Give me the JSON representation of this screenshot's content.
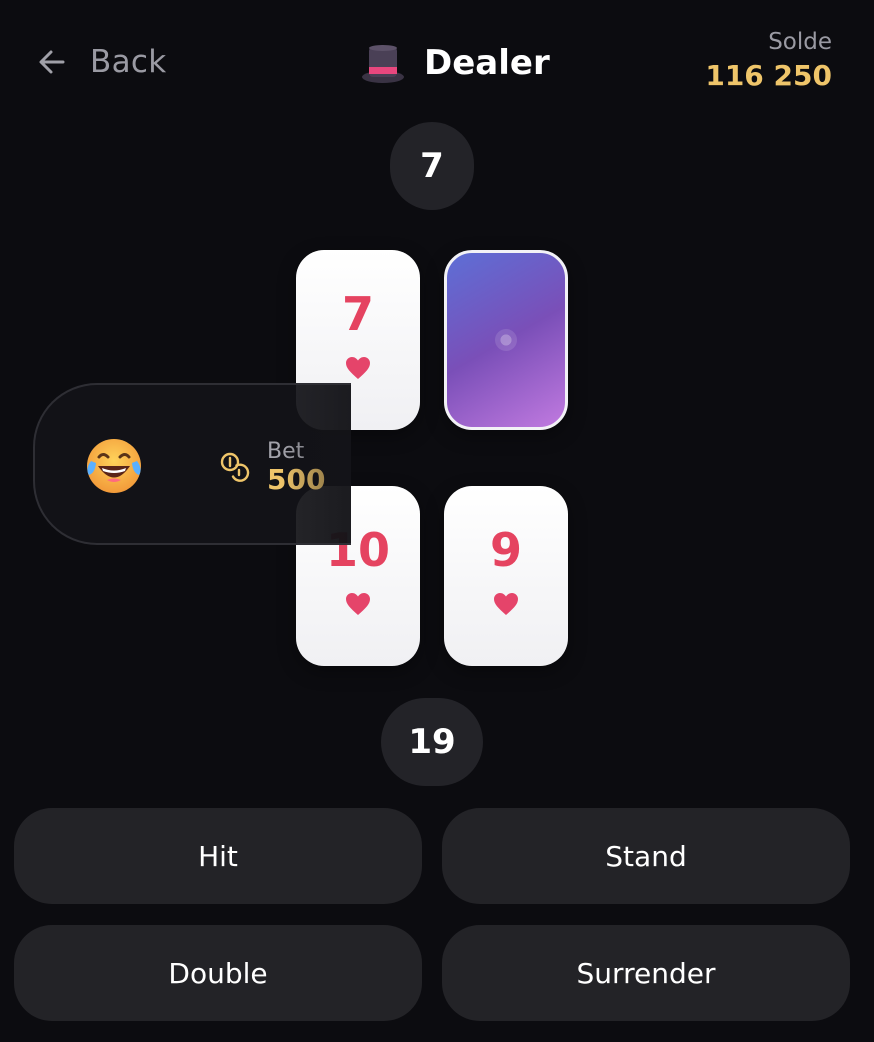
{
  "header": {
    "back_label": "Back",
    "title": "Dealer",
    "title_icon": "top-hat-icon",
    "balance_label": "Solde",
    "balance_value": "116 250"
  },
  "dealer": {
    "score": "7",
    "cards": [
      {
        "rank": "7",
        "suit": "hearts",
        "face_up": true
      },
      {
        "rank": "",
        "suit": "",
        "face_up": false
      }
    ]
  },
  "player": {
    "score": "19",
    "avatar": "laughing-tears-emoji",
    "bet_label": "Bet",
    "bet_value": "500",
    "cards": [
      {
        "rank": "10",
        "suit": "hearts",
        "face_up": true
      },
      {
        "rank": "9",
        "suit": "hearts",
        "face_up": true
      }
    ]
  },
  "actions": {
    "hit_label": "Hit",
    "stand_label": "Stand",
    "double_label": "Double",
    "surrender_label": "Surrender"
  },
  "colors": {
    "background": "#0c0c10",
    "accent_gold": "#efc56a",
    "card_red": "#e54360",
    "button_bg": "#232327"
  }
}
